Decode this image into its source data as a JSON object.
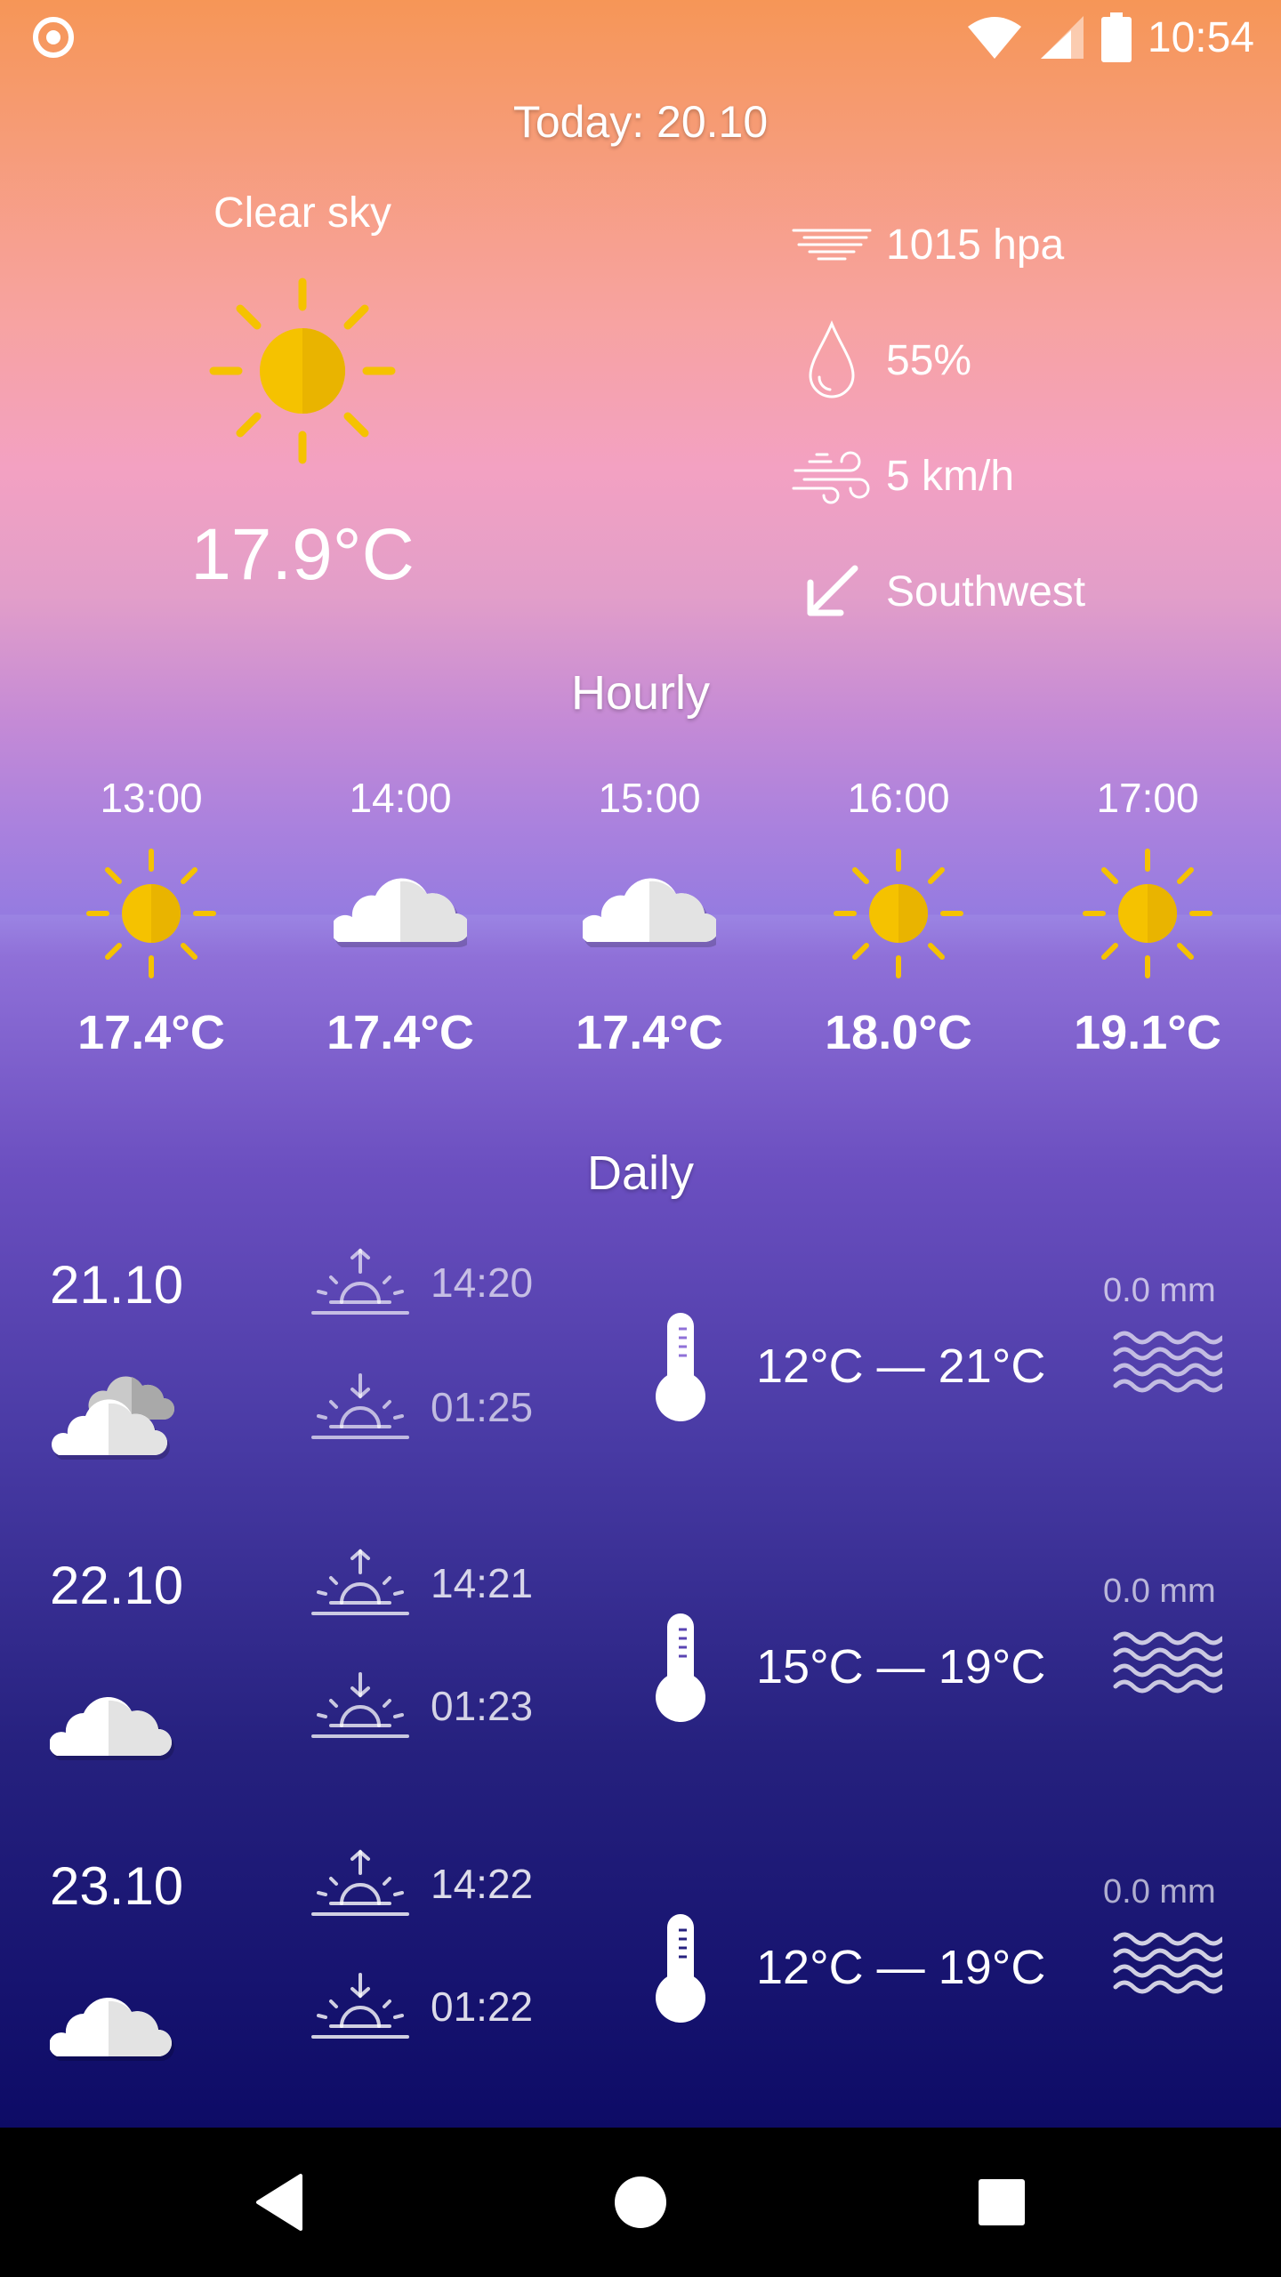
{
  "status_bar": {
    "time": "10:54",
    "icons": [
      "notification-ring-icon",
      "wifi-icon",
      "signal-icon",
      "battery-icon"
    ]
  },
  "header": {
    "title": "Today: 20.10"
  },
  "current": {
    "condition": "Clear sky",
    "icon": "sun-icon",
    "temperature": "17.9°C",
    "pressure": "1015 hpa",
    "humidity": "55%",
    "wind_speed": "5 km/h",
    "wind_direction": "Southwest"
  },
  "hourly": {
    "title": "Hourly",
    "items": [
      {
        "time": "13:00",
        "icon": "sun-icon",
        "temp": "17.4°C"
      },
      {
        "time": "14:00",
        "icon": "cloud-icon",
        "temp": "17.4°C"
      },
      {
        "time": "15:00",
        "icon": "cloud-icon",
        "temp": "17.4°C"
      },
      {
        "time": "16:00",
        "icon": "sun-icon",
        "temp": "18.0°C"
      },
      {
        "time": "17:00",
        "icon": "sun-icon",
        "temp": "19.1°C"
      }
    ]
  },
  "daily": {
    "title": "Daily",
    "items": [
      {
        "date": "21.10",
        "icon": "clouds-icon",
        "sunrise": "14:20",
        "sunset": "01:25",
        "temp_range": "12°C — 21°C",
        "rain": "0.0 mm"
      },
      {
        "date": "22.10",
        "icon": "cloud-icon",
        "sunrise": "14:21",
        "sunset": "01:23",
        "temp_range": "15°C — 19°C",
        "rain": "0.0 mm"
      },
      {
        "date": "23.10",
        "icon": "cloud-icon",
        "sunrise": "14:22",
        "sunset": "01:22",
        "temp_range": "12°C — 19°C",
        "rain": "0.0 mm"
      }
    ]
  },
  "nav": {
    "buttons": [
      "back-icon",
      "home-icon",
      "recents-icon"
    ]
  },
  "colors": {
    "sun": "#f5c200",
    "sun_dark": "#e9b400",
    "cloud": "#ffffff",
    "cloud_shade": "#e3e3e3"
  }
}
